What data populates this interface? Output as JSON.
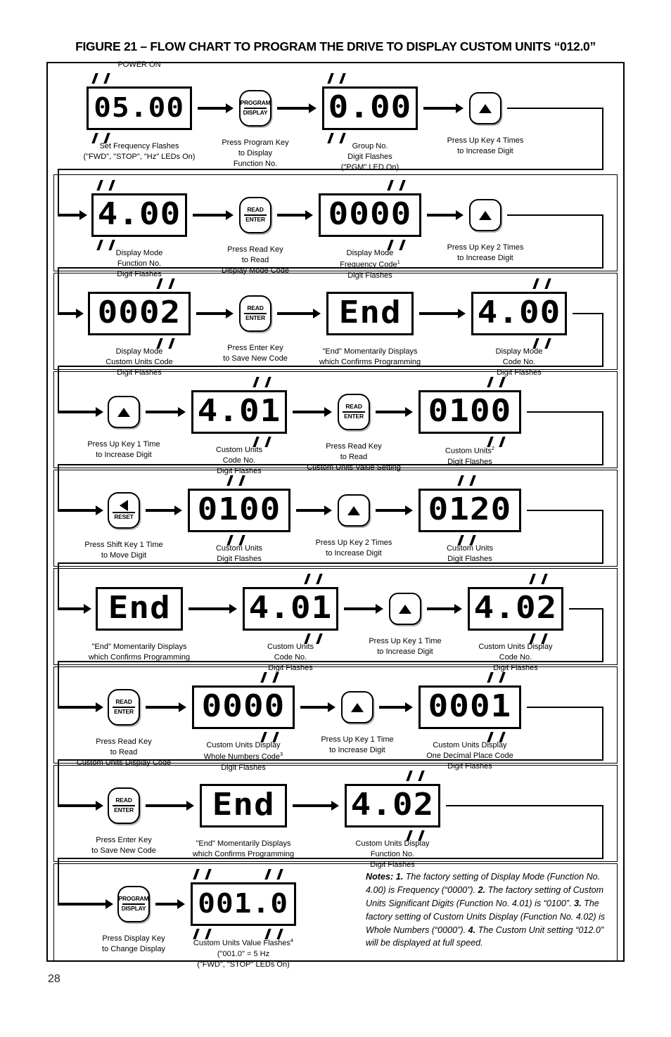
{
  "figure": {
    "title": "FIGURE 21 – FLOW CHART TO PROGRAM THE DRIVE TO DISPLAY CUSTOM UNITS “012.0”",
    "page_number": "28"
  },
  "labels": {
    "power_on": "POWER ON"
  },
  "keys": {
    "program_top": "PROGRAM",
    "program_bottom": "DISPLAY",
    "read_top": "READ",
    "read_bottom": "ENTER",
    "reset_bottom": "RESET",
    "up_icon": "up-arrow-icon",
    "shift_icon": "left-arrow-icon"
  },
  "steps": [
    {
      "id": "s1",
      "type": "display",
      "value": "05.00",
      "flash": "left",
      "caption": [
        "Set Frequency Flashes",
        "(\"FWD\", \"STOP\", \"Hz\" LEDs On)"
      ]
    },
    {
      "id": "s2",
      "type": "key-program",
      "caption": [
        "Press Program Key",
        "to Display",
        "Function No."
      ]
    },
    {
      "id": "s3",
      "type": "display",
      "value": "0.00",
      "flash": "left",
      "caption": [
        "Group No.",
        "Digit Flashes",
        "(\"PGM\" LED On)"
      ]
    },
    {
      "id": "s4",
      "type": "key-up",
      "caption": [
        "Press Up Key 4 Times",
        "to Increase Digit"
      ]
    },
    {
      "id": "s5",
      "type": "display",
      "value": "4.00",
      "flash": "left",
      "caption": [
        "Display Mode",
        "Function No.",
        "Digit Flashes"
      ]
    },
    {
      "id": "s6",
      "type": "key-read",
      "caption": [
        "Press Read Key",
        "to Read",
        "Display Mode Code"
      ]
    },
    {
      "id": "s7",
      "type": "display",
      "value": "0000",
      "flash": "right",
      "caption": [
        "Display Mode",
        "Frequency Code<sup>1</sup>",
        "Digit Flashes"
      ]
    },
    {
      "id": "s8",
      "type": "key-up",
      "caption": [
        "Press Up Key 2 Times",
        "to Increase Digit"
      ]
    },
    {
      "id": "s9",
      "type": "display",
      "value": "0002",
      "flash": "right",
      "caption": [
        "Display Mode",
        "Custom Units Code",
        "Digit Flashes"
      ]
    },
    {
      "id": "s10",
      "type": "key-read",
      "caption": [
        "Press Enter Key",
        "to Save New Code"
      ]
    },
    {
      "id": "s11",
      "type": "display",
      "value": "End",
      "flash": "none",
      "caption": [
        "\"End\" Momentarily Displays",
        "which Confirms Programming"
      ]
    },
    {
      "id": "s12",
      "type": "display",
      "value": "4.00",
      "flash": "right",
      "caption": [
        "Display Mode",
        "Code No.",
        "Digit Flashes"
      ]
    },
    {
      "id": "s13",
      "type": "key-up",
      "caption": [
        "Press Up Key 1 Time",
        "to Increase Digit"
      ]
    },
    {
      "id": "s14",
      "type": "display",
      "value": "4.01",
      "flash": "right",
      "caption": [
        "Custom Units",
        "Code No.",
        "Digit Flashes"
      ]
    },
    {
      "id": "s15",
      "type": "key-read",
      "caption": [
        "Press Read Key",
        "to Read",
        "Custom Units Value Setting"
      ]
    },
    {
      "id": "s16",
      "type": "display",
      "value": "0100",
      "flash": "right",
      "caption": [
        "Custom Units<sup>2</sup>",
        "Digit Flashes"
      ]
    },
    {
      "id": "s17",
      "type": "key-shift",
      "caption": [
        "Press Shift Key 1 Time",
        "to Move Digit"
      ]
    },
    {
      "id": "s18",
      "type": "display",
      "value": "0100",
      "flash": "mid",
      "caption": [
        "Custom Units",
        "Digit Flashes"
      ]
    },
    {
      "id": "s19",
      "type": "key-up",
      "caption": [
        "Press Up Key 2 Times",
        "to Increase Digit"
      ]
    },
    {
      "id": "s20",
      "type": "display",
      "value": "0120",
      "flash": "mid",
      "caption": [
        "Custom Units",
        "Digit Flashes"
      ]
    },
    {
      "id": "s21",
      "type": "display",
      "value": "End",
      "flash": "none",
      "caption": [
        "\"End\" Momentarily Displays",
        "which Confirms Programming"
      ]
    },
    {
      "id": "s22",
      "type": "display",
      "value": "4.01",
      "flash": "right",
      "caption": [
        "Custom Units",
        "Code No.",
        "Digit Flashes"
      ]
    },
    {
      "id": "s23",
      "type": "key-up",
      "caption": [
        "Press Up Key 1 Time",
        "to Increase Digit"
      ]
    },
    {
      "id": "s24",
      "type": "display",
      "value": "4.02",
      "flash": "right",
      "caption": [
        "Custom Units Display",
        "Code No.",
        "Digit Flashes"
      ]
    },
    {
      "id": "s25",
      "type": "key-read",
      "caption": [
        "Press Read Key",
        "to Read",
        "Custom Units Display Code"
      ]
    },
    {
      "id": "s26",
      "type": "display",
      "value": "0000",
      "flash": "right",
      "caption": [
        "Custom Units Display",
        "Whole Numbers Code<sup>3</sup>",
        "Digit Flashes"
      ]
    },
    {
      "id": "s27",
      "type": "key-up",
      "caption": [
        "Press Up Key 1 Time",
        "to Increase Digit"
      ]
    },
    {
      "id": "s28",
      "type": "display",
      "value": "0001",
      "flash": "right",
      "caption": [
        "Custom Units Display",
        "One Decimal Place Code",
        "Digit Flashes"
      ]
    },
    {
      "id": "s29",
      "type": "key-read",
      "caption": [
        "Press Enter Key",
        "to Save New Code"
      ]
    },
    {
      "id": "s30",
      "type": "display",
      "value": "End",
      "flash": "none",
      "caption": [
        "\"End\" Momentarily Displays",
        "which Confirms Programming"
      ]
    },
    {
      "id": "s31",
      "type": "display",
      "value": "4.02",
      "flash": "right",
      "caption": [
        "Custom Units Display",
        "Function No.",
        "Digit Flashes"
      ]
    },
    {
      "id": "s32",
      "type": "key-program",
      "caption": [
        "Press Display Key",
        "to Change Display"
      ]
    },
    {
      "id": "s33",
      "type": "display",
      "value": "001.0",
      "flash": "both",
      "caption": [
        "Custom Units Value Flashes<sup>4</sup>",
        "(\"001.0\" = 5 Hz",
        "(\"FWD\", \"STOP\" LEDs On)"
      ]
    }
  ],
  "notes": {
    "label": "Notes:",
    "items": [
      {
        "num": "1.",
        "text": "The factory setting of Display Mode (Function No. 4.00) is Frequency (“0000”)."
      },
      {
        "num": "2.",
        "text": "The factory setting of Custom Units Significant Digits (Function No. 4.01) is “0100”."
      },
      {
        "num": "3.",
        "text": "The factory setting of Custom Units Display (Function No. 4.02) is Whole Numbers (“0000”)."
      },
      {
        "num": "4.",
        "text": "The Custom Unit setting “012.0” will be displayed at full speed."
      }
    ]
  },
  "colors": {
    "ink": "#000000",
    "paper": "#ffffff"
  }
}
